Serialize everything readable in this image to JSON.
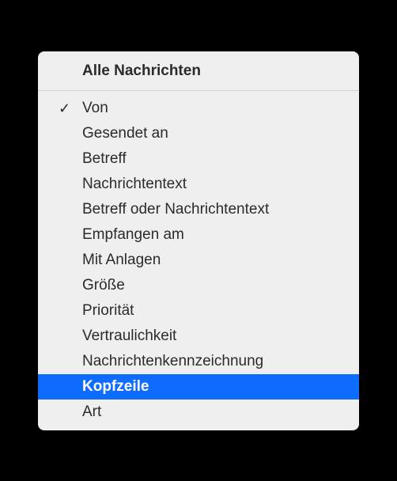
{
  "menu": {
    "header": "Alle Nachrichten",
    "items": [
      {
        "label": "Von",
        "checked": true,
        "selected": false
      },
      {
        "label": "Gesendet an",
        "checked": false,
        "selected": false
      },
      {
        "label": "Betreff",
        "checked": false,
        "selected": false
      },
      {
        "label": "Nachrichtentext",
        "checked": false,
        "selected": false
      },
      {
        "label": "Betreff oder Nachrichtentext",
        "checked": false,
        "selected": false
      },
      {
        "label": "Empfangen am",
        "checked": false,
        "selected": false
      },
      {
        "label": "Mit Anlagen",
        "checked": false,
        "selected": false
      },
      {
        "label": "Größe",
        "checked": false,
        "selected": false
      },
      {
        "label": "Priorität",
        "checked": false,
        "selected": false
      },
      {
        "label": "Vertraulichkeit",
        "checked": false,
        "selected": false
      },
      {
        "label": "Nachrichtenkennzeichnung",
        "checked": false,
        "selected": false
      },
      {
        "label": "Kopfzeile",
        "checked": false,
        "selected": true
      },
      {
        "label": "Art",
        "checked": false,
        "selected": false
      }
    ]
  }
}
